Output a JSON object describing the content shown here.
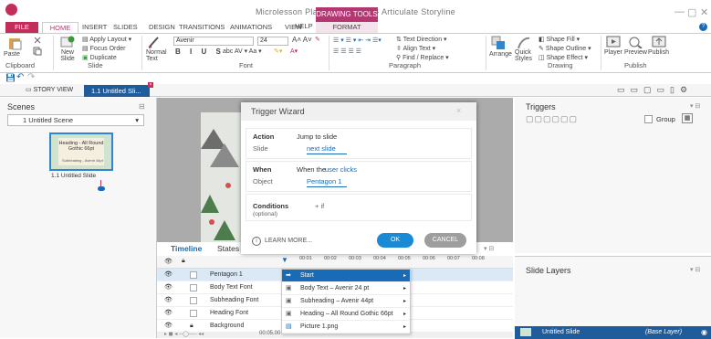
{
  "app": {
    "title": "Microlesson Plan, Part2.story* - Articulate Storyline",
    "context_header": "DRAWING TOOLS",
    "brand_color": "#c22e5a",
    "accent_color": "#1a6bb5"
  },
  "ribbon_tabs": {
    "file": "FILE",
    "home": "HOME",
    "insert": "INSERT",
    "slides": "SLIDES",
    "design": "DESIGN",
    "transitions": "TRANSITIONS",
    "animations": "ANIMATIONS",
    "view": "VIEW",
    "help": "HELP",
    "format": "FORMAT"
  },
  "ribbon": {
    "paste": "Paste",
    "new_slide": "New Slide",
    "apply_layout": "Apply Layout",
    "focus_order": "Focus Order",
    "duplicate": "Duplicate",
    "normal_text": "Normal Text",
    "font_name": "Avenir",
    "font_size": "24",
    "text_direction": "Text Direction",
    "align_text": "Align Text",
    "find_replace": "Find / Replace",
    "arrange": "Arrange",
    "quick_styles": "Quick Styles",
    "shape_fill": "Shape Fill",
    "shape_outline": "Shape Outline",
    "shape_effect": "Shape Effect",
    "player": "Player",
    "preview": "Preview",
    "publish": "Publish",
    "groups": {
      "clipboard": "Clipboard",
      "slide": "Slide",
      "font": "Font",
      "paragraph": "Paragraph",
      "drawing": "Drawing",
      "publish": "Publish"
    }
  },
  "view_tabs": {
    "story_view": "STORY VIEW",
    "current": "1.1 Untitled Sli..."
  },
  "scenes": {
    "title": "Scenes",
    "dropdown": "1 Untitled Scene",
    "thumb_title": "Heading - All Round Gothic 66pt",
    "thumb_sub": "Subheading - Avenir 44pt",
    "slide_label": "1.1 Untitled Slide"
  },
  "dialog": {
    "title": "Trigger Wizard",
    "action_label": "Action",
    "action_value": "Jump to slide",
    "slide_label": "Slide",
    "slide_value": "next slide",
    "when_label": "When",
    "when_prefix": "When the",
    "when_value": "user clicks",
    "object_label": "Object",
    "object_value": "Pentagon 1",
    "conditions_label": "Conditions",
    "conditions_sub": "(optional)",
    "add_condition": "+ if",
    "learn_more": "LEARN MORE...",
    "ok": "OK",
    "cancel": "CANCEL"
  },
  "timeline": {
    "tab_timeline": "Timeline",
    "tab_states": "States",
    "ticks": [
      "00:01",
      "00:02",
      "00:03",
      "00:04",
      "00:05",
      "00:06",
      "00:07",
      "00:08"
    ],
    "rows": [
      {
        "name": "Pentagon 1",
        "bar": "Start"
      },
      {
        "name": "Body Text Font",
        "bar": "Body Text – Avenir 24 pt"
      },
      {
        "name": "Subheading Font",
        "bar": "Subheading – Avenir 44pt"
      },
      {
        "name": "Heading Font",
        "bar": "Heading – All Round Gothic 66pt"
      },
      {
        "name": "Background",
        "bar": "Picture 1.png"
      }
    ],
    "time_readout": "00:05.00"
  },
  "triggers": {
    "title": "Triggers",
    "group": "Group"
  },
  "slide_layers": {
    "title": "Slide Layers",
    "layer_name": "Untitled Slide",
    "layer_tag": "(Base Layer)"
  }
}
